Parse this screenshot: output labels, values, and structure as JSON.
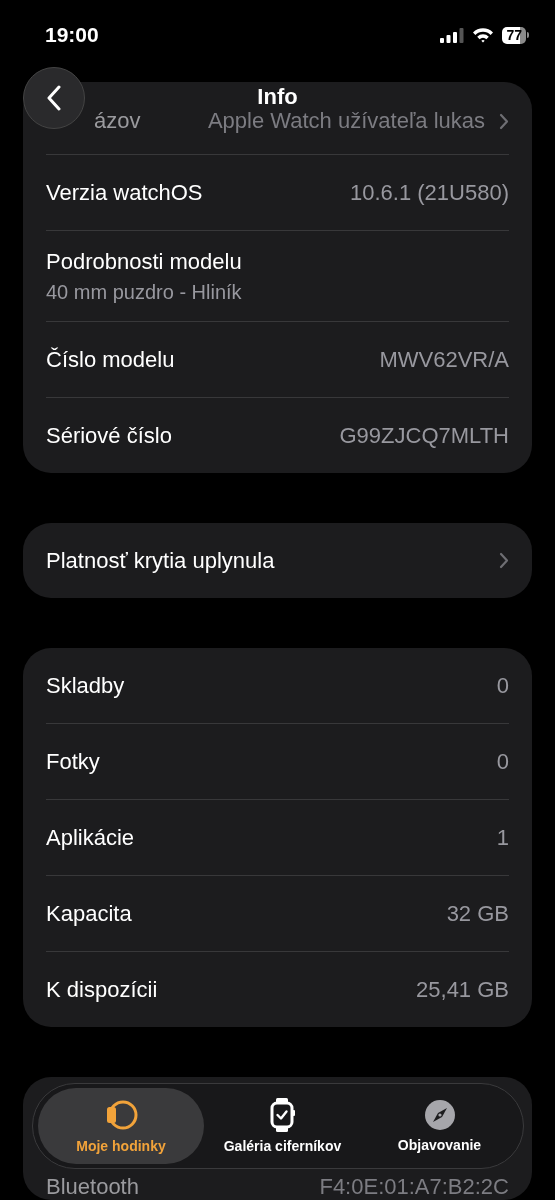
{
  "status_bar": {
    "time": "19:00",
    "battery": "77"
  },
  "nav": {
    "title": "Info"
  },
  "sections": [
    {
      "rows": [
        {
          "kind": "link",
          "label": "ázov",
          "value": "Apple Watch užívateľa lukas"
        },
        {
          "kind": "value",
          "label": "Verzia watchOS",
          "value": "10.6.1 (21U580)"
        },
        {
          "kind": "subtitle",
          "label": "Podrobnosti modelu",
          "value": "40 mm puzdro - Hliník"
        },
        {
          "kind": "value",
          "label": "Číslo modelu",
          "value": "MWV62VR/A"
        },
        {
          "kind": "value",
          "label": "Sériové číslo",
          "value": "G99ZJCQ7MLTH"
        }
      ]
    },
    {
      "rows": [
        {
          "kind": "link",
          "label": "Platnosť krytia uplynula"
        }
      ]
    },
    {
      "rows": [
        {
          "kind": "value",
          "label": "Skladby",
          "value": "0"
        },
        {
          "kind": "value",
          "label": "Fotky",
          "value": "0"
        },
        {
          "kind": "value",
          "label": "Aplikácie",
          "value": "1"
        },
        {
          "kind": "value",
          "label": "Kapacita",
          "value": "32 GB"
        },
        {
          "kind": "value",
          "label": "K dispozícii",
          "value": "25,41 GB"
        }
      ]
    },
    {
      "under_tab_bar": true,
      "rows": [
        {
          "kind": "value",
          "label": "Bluetooth",
          "value": "F4:0E:01:A7:B2:2C"
        }
      ]
    }
  ],
  "tab_bar": [
    {
      "label": "Moje hodinky",
      "selected": true
    },
    {
      "label": "Galéria ciferníkov",
      "selected": false
    },
    {
      "label": "Objavovanie",
      "selected": false
    }
  ]
}
